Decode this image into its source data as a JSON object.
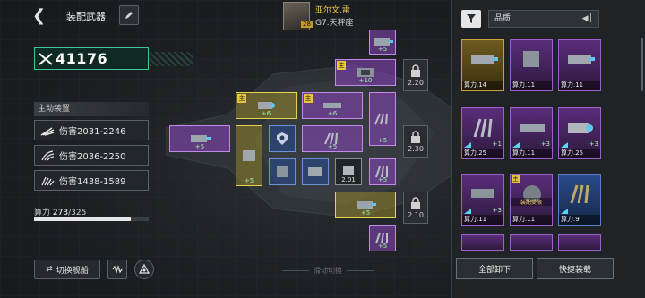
{
  "header": {
    "title": "装配武器",
    "back_icon": "back-arrow-icon",
    "edit_icon": "pencil-icon"
  },
  "pilot": {
    "level": "28",
    "name": "亚尔文.雷",
    "class": "G7.天秤座"
  },
  "power": {
    "value": "41176"
  },
  "active_equipment": {
    "label": "主动装置",
    "weapons": [
      {
        "text": "伤害2031-2246"
      },
      {
        "text": "伤害2036-2250"
      },
      {
        "text": "伤害1438-1589"
      }
    ]
  },
  "compute": {
    "label": "算力",
    "used": "273",
    "total": "/325",
    "fraction": 0.84
  },
  "bottom": {
    "switch_ship_label": "切换舰船",
    "slide_hint": "滑动切换"
  },
  "slots": {
    "main_tag": "主",
    "top_plus": "+5",
    "row1_plus": "+10",
    "row2_left_plus": "+6",
    "row2_mid_plus": "+6",
    "row2_right_plus": "+5",
    "left_plus": "+5",
    "center_plus": "+5",
    "right_plus": "+5",
    "low_left_plus": "+5",
    "cost_center": "2.01",
    "lower_plus": "+5",
    "bottom_plus": "+5",
    "locks": [
      "2.20",
      "2.30",
      "2.10"
    ]
  },
  "panel": {
    "sort_label": "品质",
    "unequip_all": "全部卸下",
    "quick_equip": "快捷装载",
    "cards": [
      {
        "power": "算力.14",
        "plus": ""
      },
      {
        "power": "算力.11",
        "plus": ""
      },
      {
        "power": "算力.11",
        "plus": ""
      },
      {
        "power": "算力.25",
        "plus": "+1"
      },
      {
        "power": "算力.11",
        "plus": "+3"
      },
      {
        "power": "算力.25",
        "plus": "+3"
      },
      {
        "power": "算力.11",
        "plus": "+3"
      },
      {
        "power": "算力.11",
        "plus": "",
        "tag": "主",
        "badge": "装配受限"
      },
      {
        "power": "算力.9",
        "plus": ""
      }
    ]
  },
  "colors": {
    "accent_green": "#3fc59a",
    "gold": "#e7d44a",
    "purple": "#c08be8",
    "pilot_name": "#f2c84b"
  }
}
